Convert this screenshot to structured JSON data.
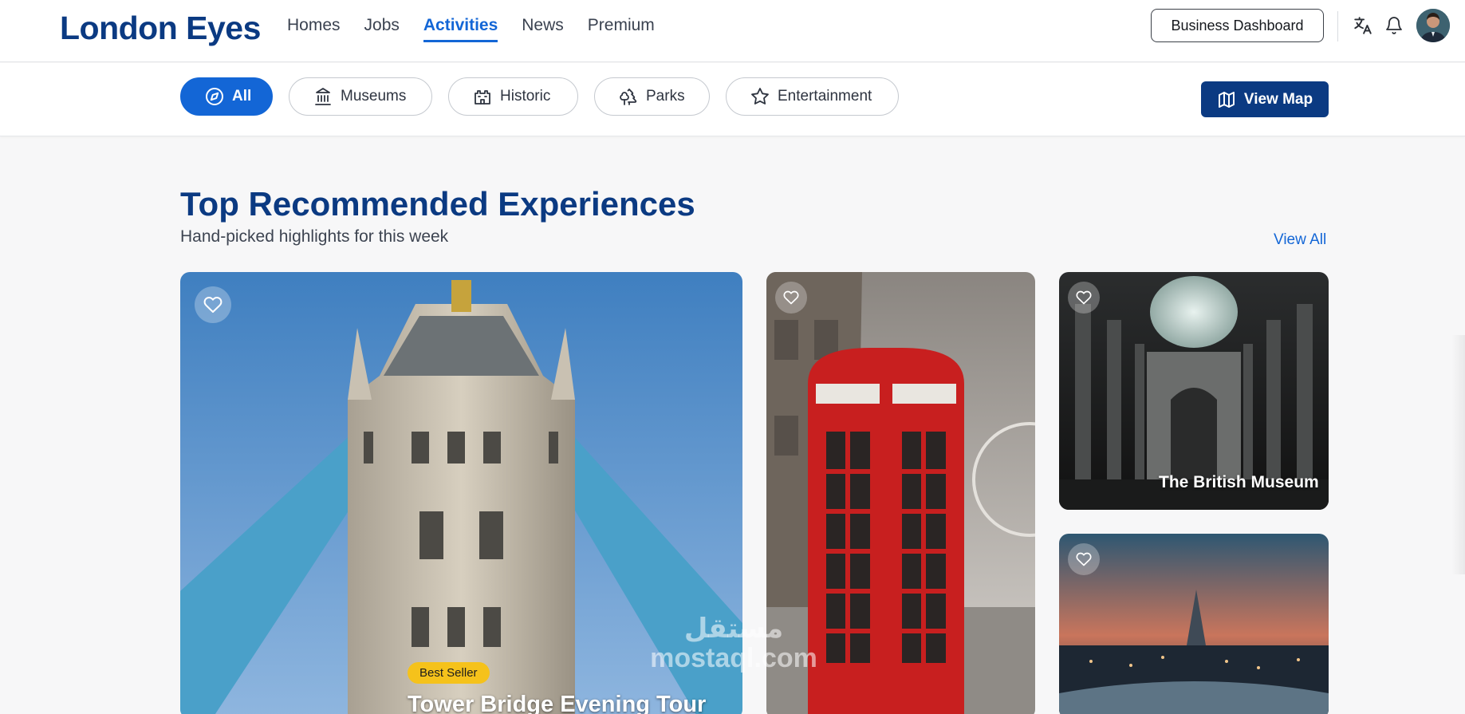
{
  "brand": {
    "name": "London Eyes"
  },
  "nav": {
    "items": [
      {
        "label": "Homes"
      },
      {
        "label": "Jobs"
      },
      {
        "label": "Activities",
        "active": true
      },
      {
        "label": "News"
      },
      {
        "label": "Premium"
      }
    ]
  },
  "header": {
    "business_label": "Business Dashboard",
    "icons": [
      "translate-icon",
      "bell-icon",
      "avatar"
    ]
  },
  "filters": {
    "chips": [
      {
        "label": "All",
        "icon": "compass-icon",
        "active": true
      },
      {
        "label": "Museums",
        "icon": "museum-icon"
      },
      {
        "label": "Historic",
        "icon": "castle-icon"
      },
      {
        "label": "Parks",
        "icon": "trees-icon"
      },
      {
        "label": "Entertainment",
        "icon": "star-icon"
      }
    ],
    "map_label": "View Map"
  },
  "section": {
    "title": "Top Recommended Experiences",
    "subtitle": "Hand-picked highlights for this week",
    "view_all": "View All"
  },
  "cards": {
    "tower": {
      "badge": "Best Seller",
      "title": "Tower Bridge Evening Tour"
    },
    "phone": {},
    "museum": {
      "title": "The British Museum"
    },
    "skyline": {}
  },
  "watermark": {
    "line1": "مستقل",
    "line2": "mostaql.com"
  },
  "colors": {
    "brand": "#0b3a82",
    "accent": "#1366d6",
    "badge": "#f5c21b"
  }
}
